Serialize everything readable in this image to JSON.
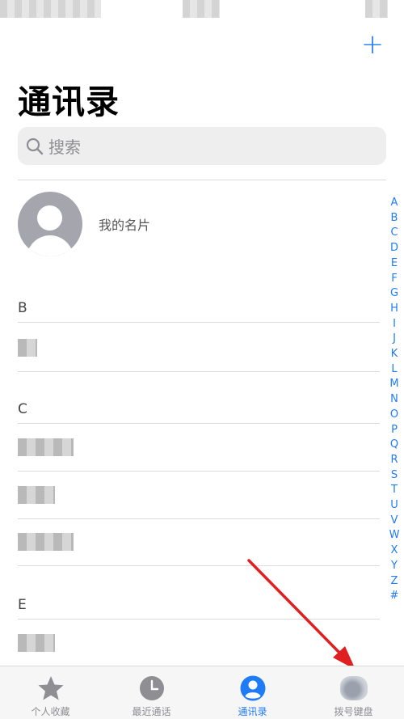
{
  "header": {
    "title": "通讯录",
    "add_label": "+"
  },
  "search": {
    "placeholder": "搜索"
  },
  "my_card": {
    "label": "我的名片"
  },
  "sections": [
    {
      "letter": "B"
    },
    {
      "letter": "C"
    },
    {
      "letter": "E"
    }
  ],
  "index_letters": [
    "A",
    "B",
    "C",
    "D",
    "E",
    "F",
    "G",
    "H",
    "I",
    "J",
    "K",
    "L",
    "M",
    "N",
    "O",
    "P",
    "Q",
    "R",
    "S",
    "T",
    "U",
    "V",
    "W",
    "X",
    "Y",
    "Z",
    "#"
  ],
  "tabs": [
    {
      "label": "个人收藏",
      "icon": "star-icon",
      "active": false
    },
    {
      "label": "最近通话",
      "icon": "clock-icon",
      "active": false
    },
    {
      "label": "通讯录",
      "icon": "person-circle-icon",
      "active": true
    },
    {
      "label": "拨号键盘",
      "icon": "keypad-icon",
      "active": false
    }
  ],
  "colors": {
    "accent": "#1f7cf5",
    "annotation_arrow": "#e02020"
  }
}
